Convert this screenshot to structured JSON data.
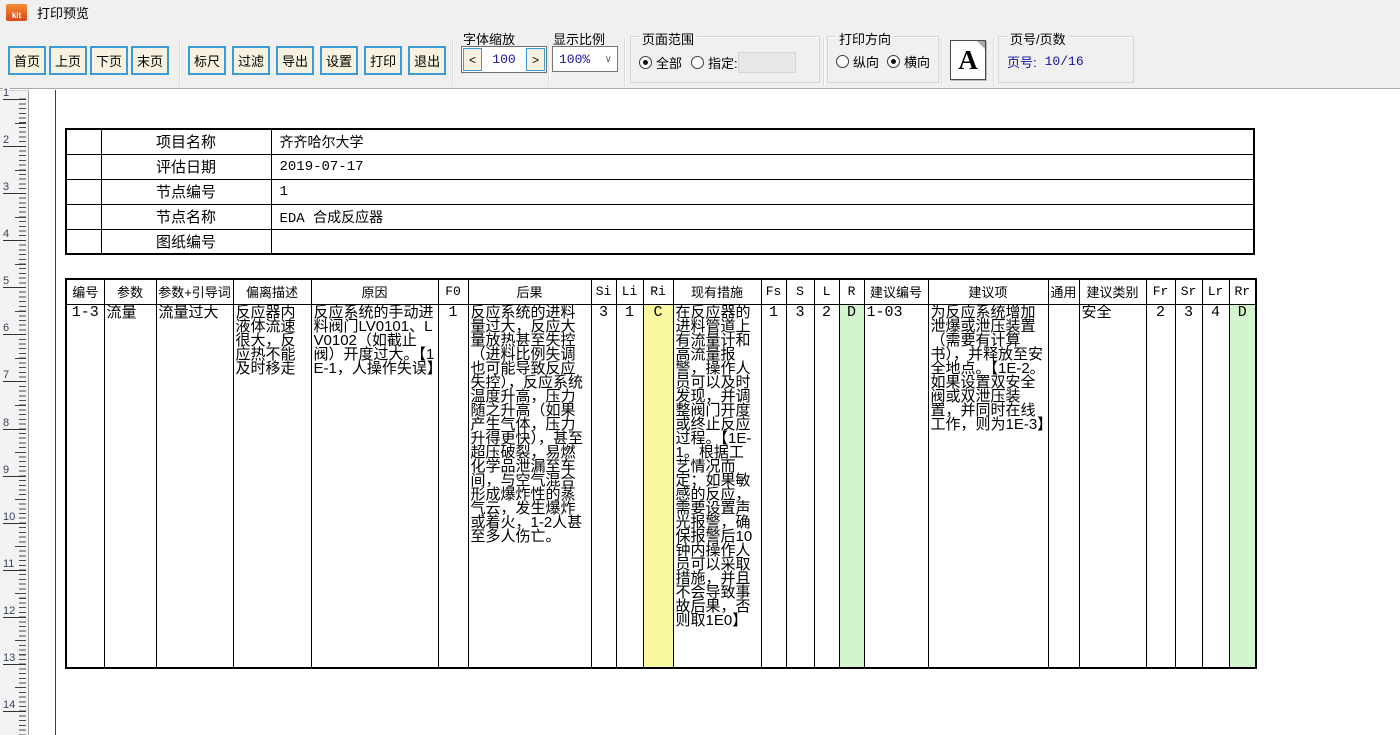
{
  "window": {
    "title": "打印预览",
    "app_icon_text": "kit"
  },
  "toolbar": {
    "nav_buttons": [
      {
        "label": "首页"
      },
      {
        "label": "上页"
      },
      {
        "label": "下页"
      },
      {
        "label": "末页"
      }
    ],
    "action_buttons": [
      {
        "label": "标尺"
      },
      {
        "label": "过滤"
      },
      {
        "label": "导出"
      },
      {
        "label": "设置"
      },
      {
        "label": "打印"
      },
      {
        "label": "退出"
      }
    ],
    "font_scale": {
      "label": "字体缩放",
      "decrease_label": "<",
      "value": "100",
      "increase_label": ">"
    },
    "display_ratio": {
      "label": "显示比例",
      "value": "100%",
      "dropdown_arrow": "∨"
    },
    "page_range": {
      "label": "页面范围",
      "option_all": "全部",
      "option_specify": "指定:",
      "all_selected": true,
      "specify_selected": false,
      "specify_value": ""
    },
    "orientation": {
      "label": "打印方向",
      "option_portrait": "纵向",
      "option_landscape": "横向",
      "portrait_selected": false,
      "landscape_selected": true,
      "icon_letter": "A"
    },
    "page_number": {
      "label": "页号/页数",
      "prefix": "页号:",
      "value": "10/16"
    }
  },
  "ruler": {
    "marks": [
      "1",
      "2",
      "3",
      "4",
      "5",
      "6",
      "7",
      "8",
      "9",
      "10",
      "11",
      "12",
      "13",
      "14"
    ]
  },
  "info_table": {
    "rows": [
      {
        "label": "项目名称",
        "value": "齐齐哈尔大学"
      },
      {
        "label": "评估日期",
        "value": "2019-07-17"
      },
      {
        "label": "节点编号",
        "value": "1"
      },
      {
        "label": "节点名称",
        "value": "EDA 合成反应器"
      },
      {
        "label": "图纸编号",
        "value": ""
      }
    ]
  },
  "main_table": {
    "headers": [
      "编号",
      "参数",
      "参数+引导词",
      "偏离描述",
      "原因",
      "F0",
      "后果",
      "Si",
      "Li",
      "Ri",
      "现有措施",
      "Fs",
      "S",
      "L",
      "R",
      "建议编号",
      "建议项",
      "通用",
      "建议类别",
      "Fr",
      "Sr",
      "Lr",
      "Rr"
    ],
    "row": [
      "1-3",
      "流量",
      "流量过大",
      "反应器内液体流速很大，反应热不能及时移走",
      "反应系统的手动进料阀门LV0101、LV0102（如截止阀）开度过大。【1E-1，人操作失误】",
      "1",
      "反应系统的进料量过大，反应大量放热甚至失控（进料比例失调也可能导致反应失控），反应系统温度升高，压力随之升高（如果产生气体，压力升得更快），甚至超压破裂，易燃化学品泄漏至车间，与空气混合形成爆炸性的蒸气云，发生爆炸或着火，1-2人甚至多人伤亡。",
      "3",
      "1",
      "C",
      "在反应器的进料管道上有流量计和高流量报警，操作人员可以及时发现，并调整阀门开度或终止反应过程。【1E-1。根据工艺情况而定；如果敏感的反应，需要设置声光报警，确保报警后10钟内操作人员可以采取措施，并且不会导致事故后果，否则取1E0】",
      "1",
      "3",
      "2",
      "D",
      "1-03",
      "为反应系统增加泄爆或泄压装置（需要有计算书），并释放至安全地点。【1E-2。如果设置双安全阀或双泄压装置，并同时在线工作，则为1E-3】",
      "",
      "安全",
      "2",
      "3",
      "4",
      "D"
    ],
    "risk_cell_colors": {
      "Ri": "#fbf8a2",
      "R": "#d3f5cd",
      "Rr": "#d3f5cd"
    }
  }
}
